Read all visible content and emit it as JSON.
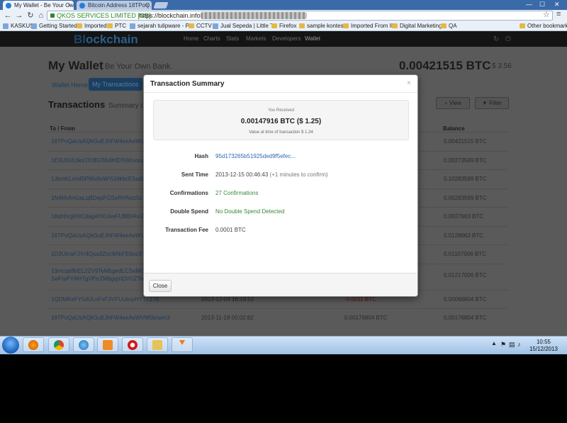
{
  "browser": {
    "tabs": [
      {
        "title": "My Wallet - Be Your Own"
      },
      {
        "title": "Bitcoin Address 18TPoQ..."
      }
    ],
    "window_controls": {
      "minimize": "—",
      "maximize": "☐",
      "close": "✕"
    },
    "ev_certificate": "QKOS SERVICES LIMITED [GB]",
    "url": "https://blockchain.info",
    "bookmarks": [
      {
        "label": "KASKUS",
        "kind": "page"
      },
      {
        "label": "Getting Started",
        "kind": "page"
      },
      {
        "label": "Imported",
        "kind": "folder"
      },
      {
        "label": "PTC",
        "kind": "folder"
      },
      {
        "label": "sejarah tulipware - P...",
        "kind": "page"
      },
      {
        "label": "CCTV",
        "kind": "folder"
      },
      {
        "label": "Jual Sepeda | Little T...",
        "kind": "page"
      },
      {
        "label": "Firefox",
        "kind": "folder"
      },
      {
        "label": "sample kontes",
        "kind": "folder"
      },
      {
        "label": "Imported From IE",
        "kind": "folder"
      },
      {
        "label": "Digital Marketing",
        "kind": "folder"
      },
      {
        "label": "QA",
        "kind": "folder"
      }
    ],
    "other_bookmarks": "Other bookmarks"
  },
  "site": {
    "logo_prefix": "Bl",
    "logo_o": "o",
    "logo_suffix": "ckchain",
    "nav": [
      "Home",
      "Charts",
      "Stats",
      "Markets",
      "Developers",
      "Wallet"
    ]
  },
  "wallet": {
    "title": "My Wallet",
    "subtitle": "Be Your Own Bank.",
    "balance_btc": "0.00421515 BTC",
    "balance_usd": "$ 3.56",
    "tabs": {
      "home": "Wallet Home",
      "my_transactions": "My Transactions"
    },
    "transactions_title": "Transactions",
    "transactions_sub": "Summary o",
    "view_label": "View",
    "filter_label": "Filter",
    "columns": {
      "to_from": "To / From",
      "balance": "Balance"
    },
    "rows": [
      {
        "addr": "18TPoQaUsAQkGuEJhFW4exAeWVM5",
        "date": "",
        "amount": "",
        "balance": "0.00421515 BTC"
      },
      {
        "addr": "1E3U5ULbkzJTcBGSfu9HDToWxooy...",
        "date": "",
        "amount": "",
        "balance": "0.00273599 BTC"
      },
      {
        "addr": "1JbmKLvndSPWu9uWYiJdkbcE5adbM",
        "date": "",
        "amount": "",
        "balance": "0.10283599 BTC"
      },
      {
        "addr": "1N4MvfmUaLqBDepFGSeRHNdz5z7NJ8",
        "date": "",
        "amount": "",
        "balance": "0.00283599 BTC"
      },
      {
        "addr": "18qHhrgKHCdag4HXUveFUBBrRxrZ8bV",
        "date": "",
        "amount": "",
        "balance": "0.0027663 BTC"
      },
      {
        "addr": "18TPoQaUsAQkGuEJhFW4exAeWVM5",
        "date": "",
        "amount": "",
        "balance": "0.0128663 BTC"
      },
      {
        "addr": "1D3UtnaFJYr4Qua3Zoc9AbFE6ez3TAS",
        "date": "",
        "amount": "",
        "balance": "0.01107006 BTC"
      },
      {
        "addr": "13mcqa9bEL2ZV9TeMbgedLCSeMGU",
        "addr2": "1wFtsPYNH7gVPrrZM6gqmDVUZTaq",
        "date": "",
        "amount": "",
        "balance": "0.01217006 BTC"
      },
      {
        "addr": "1QDMKeFY5dULnFxF3VFUuboyHYTL17E",
        "date": "2013-12-04 16:19:52",
        "amount": "-0.0011 BTC",
        "balance": "0.00066804 BTC"
      },
      {
        "addr": "18TPoQaUsAQkGuEJhFW4exAeWVM5bnam3",
        "date": "2013-11-18 00:02:82",
        "amount": "0.00176804 BTC",
        "balance": "0.00176804 BTC"
      }
    ]
  },
  "modal": {
    "title": "Transaction Summary",
    "close_x": "×",
    "received_label": "You Received",
    "received_amount": "0.00147916 BTC ($ 1.25)",
    "received_value_note": "Value at time of transaction $ 1.34",
    "fields": {
      "hash_label": "Hash",
      "hash_value": "95d173265b51925ded9f5efec...",
      "sent_label": "Sent Time",
      "sent_value": "2013-12-15 00:46:43",
      "sent_sub": "(+1 minutes to confirm)",
      "conf_label": "Confirmations",
      "conf_value": "27 Confirmations",
      "double_label": "Double Spend",
      "double_value": "No Double Spend Detected",
      "fee_label": "Transaction Fee",
      "fee_value": "0.0001 BTC"
    },
    "close_button": "Close"
  },
  "taskbar": {
    "apps": [
      "explorer",
      "firefox",
      "chrome",
      "ie",
      "media-player",
      "opera",
      "folder",
      "vlc"
    ],
    "time": "10:55",
    "date": "15/12/2013"
  }
}
